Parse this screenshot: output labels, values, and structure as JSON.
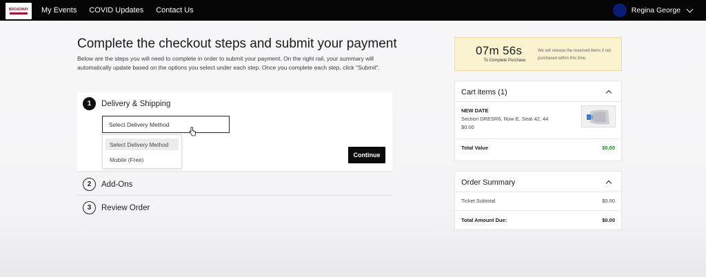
{
  "nav": {
    "logo_text": "BROADWAY",
    "links": [
      "My Events",
      "COVID Updates",
      "Contact Us"
    ],
    "user_name": "Regina George"
  },
  "main": {
    "title": "Complete the checkout steps and submit your payment",
    "intro": "Below are the steps you will need to complete in order to submit your payment. On the right rail, your summary will automatically update based on the options you select under each step. Once you complete each step, click \"Submit\".",
    "steps": [
      {
        "num": "1",
        "label": "Delivery & Shipping"
      },
      {
        "num": "2",
        "label": "Add-Ons"
      },
      {
        "num": "3",
        "label": "Review Order"
      }
    ],
    "delivery_select_value": "Select Delivery Method",
    "delivery_options": [
      "Select Delivery Method",
      "Mobile (Free)"
    ],
    "continue_label": "Continue"
  },
  "timer": {
    "time": "07m 56s",
    "sub": "To Complete Purchase",
    "note": "We will release the reserved items if not purchased within this time."
  },
  "cart": {
    "heading": "Cart items (1)",
    "item_name": "NEW DATE",
    "item_detail": "Section DRESR6, Row E, Seat 42, 44",
    "item_price": "$0.00",
    "total_label": "Total Value",
    "total_value": "$0.00"
  },
  "summary": {
    "heading": "Order Summary",
    "subtotal_label": "Ticket Subtotal",
    "subtotal_value": "$0.00",
    "due_label": "Total Amount Due:",
    "due_value": "$0.00"
  },
  "colors": {
    "topbar": "#050505",
    "avatar": "#0c1b73",
    "timer_bg": "#fbf3d0",
    "total_green": "#2e7d32"
  }
}
